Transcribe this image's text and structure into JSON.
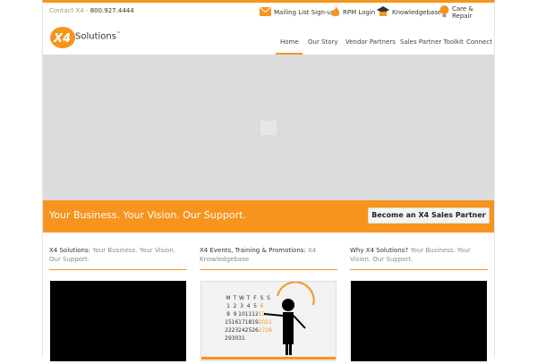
{
  "topbar": {
    "contact_label": "Contact X4 - ",
    "contact_phone": "800.927.4444",
    "links": [
      {
        "label": "Mailing List Sign-up",
        "icon": "envelope-icon"
      },
      {
        "label": "RPM Login",
        "icon": "flame-icon"
      },
      {
        "label": "Knowledgebase",
        "icon": "graduation-cap-icon"
      },
      {
        "label": "Care & Repair",
        "icon": "lightbulb-icon"
      }
    ]
  },
  "header": {
    "logo_mark": "X4",
    "logo_text": "Solutions",
    "logo_tm": "™",
    "nav": [
      "Home",
      "Our Story",
      "Vendor Partners",
      "Sales Partner Toolkit",
      "Connect"
    ]
  },
  "band": {
    "tagline": "Your Business. Your Vision. Our Support.",
    "button": "Become an X4 Sales Partner"
  },
  "columns": [
    {
      "title": "X4 Solutions:",
      "subtitle": "Your Business. Your Vision. Our Support."
    },
    {
      "title": "X4 Events, Training & Promotions:",
      "subtitle": "X4 Knowledgebase"
    },
    {
      "title": "Why X4 Solutions?",
      "subtitle": "Your Business. Your Vision. Our Support."
    }
  ],
  "calendar": {
    "days": [
      "M",
      "T",
      "W",
      "T",
      "F",
      "S",
      "S"
    ],
    "rows": [
      [
        "1",
        "2",
        "3",
        "4",
        "5",
        "6",
        ""
      ],
      [
        "8",
        "9",
        "10",
        "11",
        "12",
        "13",
        ""
      ],
      [
        "15",
        "16",
        "17",
        "18",
        "19",
        "20",
        "21"
      ],
      [
        "22",
        "23",
        "24",
        "25",
        "26",
        "27",
        "28"
      ],
      [
        "29",
        "30",
        "31",
        "",
        "",
        "",
        ""
      ]
    ]
  },
  "colors": {
    "accent": "#f7941d",
    "hero": "#dcdcdc"
  }
}
